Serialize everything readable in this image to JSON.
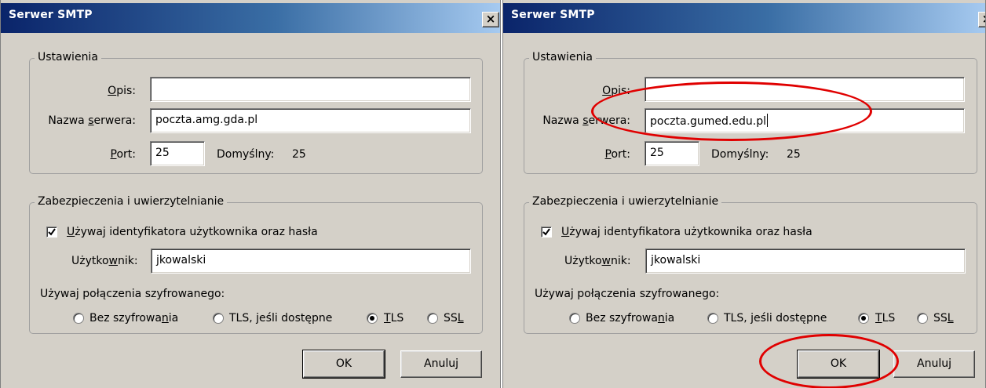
{
  "colors": {
    "titlebar": "#0a246a",
    "dialog_bg": "#d4d0c8",
    "highlight": "#e00000"
  },
  "dialogs": [
    {
      "title": "Serwer SMTP",
      "close_glyph": "×",
      "settings": {
        "legend": "Ustawienia",
        "description": {
          "label_pre": "",
          "label_key": "O",
          "label_post": "pis:",
          "value": ""
        },
        "server": {
          "label_pre": "Nazwa ",
          "label_key": "s",
          "label_post": "erwera:",
          "value": "poczta.amg.gda.pl"
        },
        "port": {
          "label_pre": "",
          "label_key": "P",
          "label_post": "ort:",
          "value": "25",
          "default_label": "Domyślny:",
          "default_value": "25"
        }
      },
      "security": {
        "legend": "Zabezpieczenia i uwierzytelnianie",
        "use_auth": {
          "checked": true,
          "label_pre": "",
          "label_key": "U",
          "label_post": "żywaj identyfikatora użytkownika oraz hasła"
        },
        "user": {
          "label_pre": "Użytko",
          "label_key": "w",
          "label_post": "nik:",
          "value": "jkowalski"
        },
        "encryption_label": "Używaj połączenia szyfrowanego:",
        "options": [
          {
            "pre": "Bez szyfrowa",
            "key": "n",
            "post": "ia",
            "selected": false
          },
          {
            "pre": "TLS, ",
            "key": "j",
            "post": "eśli dostępne",
            "selected": false
          },
          {
            "pre": "",
            "key": "T",
            "post": "LS",
            "selected": true
          },
          {
            "pre": "SS",
            "key": "L",
            "post": "",
            "selected": false
          }
        ]
      },
      "ok_label": "OK",
      "cancel_label": "Anuluj"
    },
    {
      "title": "Serwer SMTP",
      "close_glyph": "×",
      "settings": {
        "legend": "Ustawienia",
        "description": {
          "label_pre": "",
          "label_key": "O",
          "label_post": "pis:",
          "value": ""
        },
        "server": {
          "label_pre": "Nazwa ",
          "label_key": "s",
          "label_post": "erwera:",
          "value": "poczta.gumed.edu.pl"
        },
        "port": {
          "label_pre": "",
          "label_key": "P",
          "label_post": "ort:",
          "value": "25",
          "default_label": "Domyślny:",
          "default_value": "25"
        }
      },
      "security": {
        "legend": "Zabezpieczenia i uwierzytelnianie",
        "use_auth": {
          "checked": true,
          "label_pre": "",
          "label_key": "U",
          "label_post": "żywaj identyfikatora użytkownika oraz hasła"
        },
        "user": {
          "label_pre": "Użytko",
          "label_key": "w",
          "label_post": "nik:",
          "value": "jkowalski"
        },
        "encryption_label": "Używaj połączenia szyfrowanego:",
        "options": [
          {
            "pre": "Bez szyfrowa",
            "key": "n",
            "post": "ia",
            "selected": false
          },
          {
            "pre": "TLS, ",
            "key": "j",
            "post": "eśli dostępne",
            "selected": false
          },
          {
            "pre": "",
            "key": "T",
            "post": "LS",
            "selected": true
          },
          {
            "pre": "SS",
            "key": "L",
            "post": "",
            "selected": false
          }
        ]
      },
      "ok_label": "OK",
      "cancel_label": "Anuluj"
    }
  ]
}
